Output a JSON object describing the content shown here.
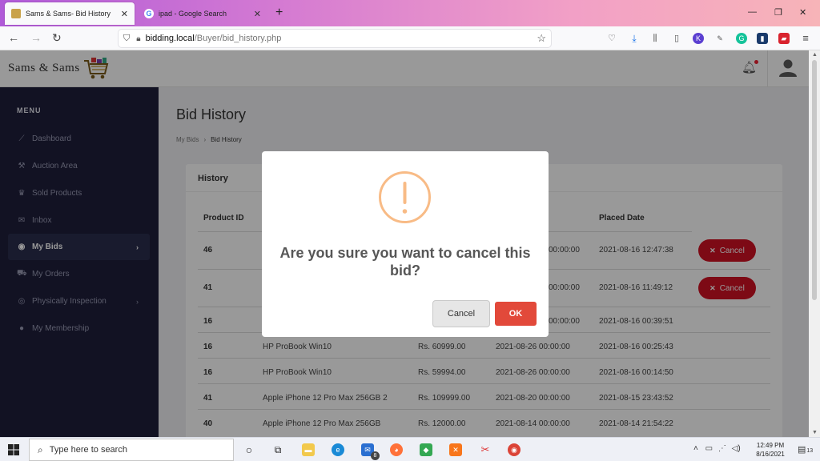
{
  "browser": {
    "tabs": [
      {
        "title": "Sams & Sams- Bid History",
        "active": true
      },
      {
        "title": "ipad - Google Search",
        "active": false
      }
    ],
    "url_host": "bidding.local",
    "url_path": "/Buyer/bid_history.php"
  },
  "app": {
    "brand": "Sams & Sams",
    "menu_title": "MENU",
    "sidebar": [
      {
        "label": "Dashboard",
        "icon": "chart-icon"
      },
      {
        "label": "Auction Area",
        "icon": "gavel-icon"
      },
      {
        "label": "Sold Products",
        "icon": "trophy-icon"
      },
      {
        "label": "Inbox",
        "icon": "envelope-icon"
      },
      {
        "label": "My Bids",
        "icon": "user-circle-icon",
        "active": true
      },
      {
        "label": "My Orders",
        "icon": "truck-icon"
      },
      {
        "label": "Physically Inspection",
        "icon": "eye-icon"
      },
      {
        "label": "My Membership",
        "icon": "circle-icon"
      }
    ]
  },
  "page": {
    "title": "Bid History",
    "breadcrumb": [
      "My Bids",
      "Bid History"
    ],
    "card_title": "History",
    "columns": {
      "product_id": "Product ID",
      "placed_date": "Placed Date"
    },
    "rows": [
      {
        "id": "46",
        "name": "",
        "amount": "",
        "end": "00:00:00",
        "placed": "2021-08-16 12:47:38",
        "cancel": "Cancel"
      },
      {
        "id": "41",
        "name": "",
        "amount": "",
        "end": "00:00:00",
        "placed": "2021-08-16 11:49:12",
        "cancel": "Cancel"
      },
      {
        "id": "16",
        "name": "",
        "amount": "",
        "end": "00:00:00",
        "placed": "2021-08-16 00:39:51",
        "cancel": ""
      },
      {
        "id": "16",
        "name": "HP ProBook Win10",
        "amount": "Rs. 60999.00",
        "end": "2021-08-26 00:00:00",
        "placed": "2021-08-16 00:25:43",
        "cancel": ""
      },
      {
        "id": "16",
        "name": "HP ProBook Win10",
        "amount": "Rs. 59994.00",
        "end": "2021-08-26 00:00:00",
        "placed": "2021-08-16 00:14:50",
        "cancel": ""
      },
      {
        "id": "41",
        "name": "Apple iPhone 12 Pro Max 256GB 2",
        "amount": "Rs. 109999.00",
        "end": "2021-08-20 00:00:00",
        "placed": "2021-08-15 23:43:52",
        "cancel": ""
      },
      {
        "id": "40",
        "name": "Apple iPhone 12 Pro Max 256GB",
        "amount": "Rs. 12000.00",
        "end": "2021-08-14 00:00:00",
        "placed": "2021-08-14 21:54:22",
        "cancel": ""
      }
    ]
  },
  "dialog": {
    "message": "Are you sure you want to cancel this bid?",
    "cancel_label": "Cancel",
    "ok_label": "OK"
  },
  "taskbar": {
    "search_placeholder": "Type here to search",
    "time": "12:49 PM",
    "date": "8/16/2021",
    "mail_badge": "8",
    "notif_count": "13"
  },
  "colors": {
    "sidebar_bg": "#1e1f3b",
    "cancel_red": "#d01224",
    "ok_red": "#e2493a",
    "warning_orange": "#f8bb86"
  }
}
